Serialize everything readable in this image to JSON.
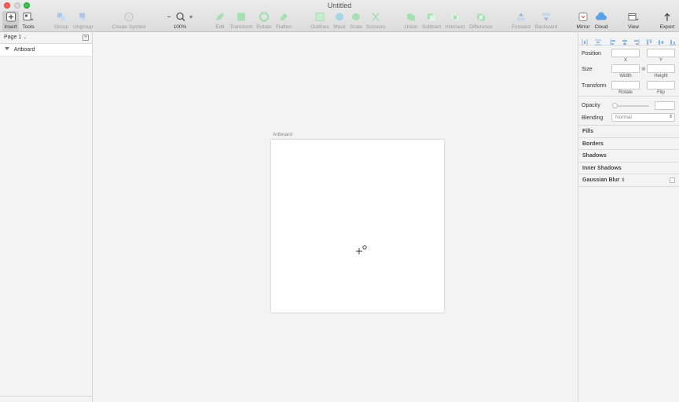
{
  "window": {
    "title": "Untitled"
  },
  "toolbar": {
    "insert": "Insert",
    "tools": "Tools",
    "group": "Group",
    "ungroup": "Ungroup",
    "create_symbol": "Create Symbol",
    "zoom": "100%",
    "edit": "Edit",
    "transform": "Transform",
    "rotate": "Rotate",
    "flatten": "Flatten",
    "outlines": "Outlines",
    "mask": "Mask",
    "scale": "Scale",
    "scissors": "Scissors",
    "union": "Union",
    "subtract": "Subtract",
    "intersect": "Intersect",
    "difference": "Difference",
    "forward": "Forward",
    "backward": "Backward",
    "mirror": "Mirror",
    "cloud": "Cloud",
    "view": "View",
    "export": "Export"
  },
  "sidebar": {
    "page": "Page 1",
    "layers": [
      {
        "name": "Artboard"
      }
    ]
  },
  "canvas": {
    "artboard_label": "Artboard"
  },
  "inspector": {
    "position": "Position",
    "x": "X",
    "y": "Y",
    "size": "Size",
    "width": "Width",
    "height": "Height",
    "transform": "Transform",
    "rotate": "Rotate",
    "flip": "Flip",
    "opacity": "Opacity",
    "blending": "Blending",
    "blending_value": "Normal",
    "fills": "Fills",
    "borders": "Borders",
    "shadows": "Shadows",
    "inner_shadows": "Inner Shadows",
    "gaussian_blur": "Gaussian Blur"
  },
  "colors": {
    "accent": "#5aa0e6",
    "toolbar_tint": "#8fd6a0"
  }
}
